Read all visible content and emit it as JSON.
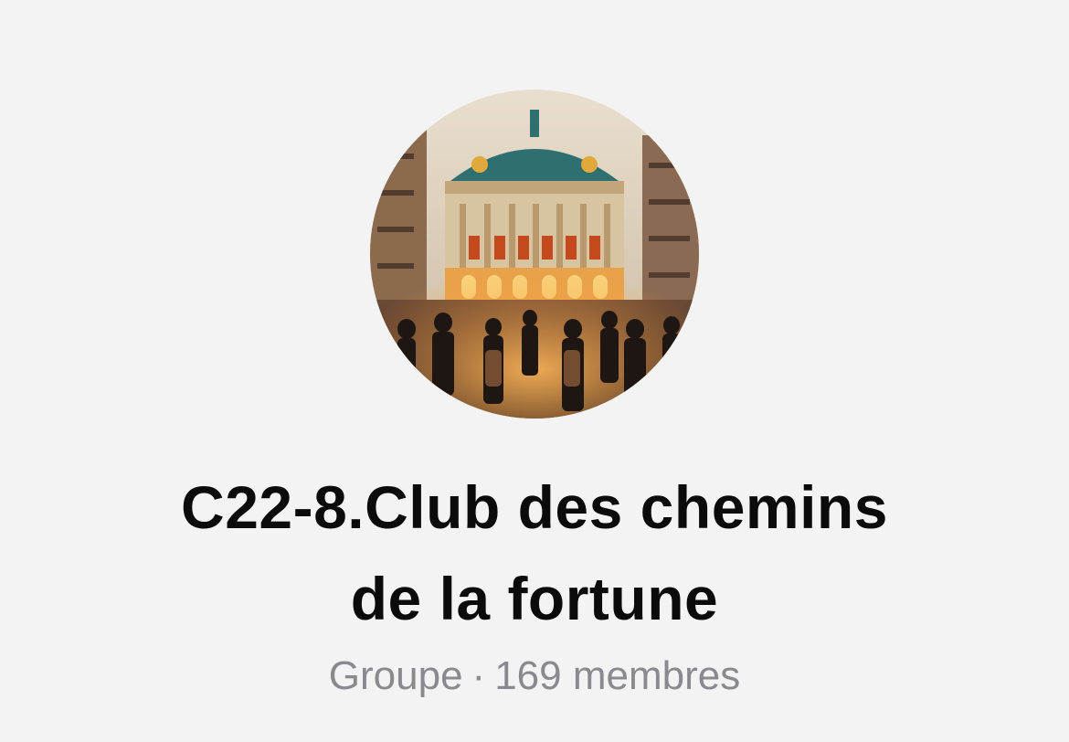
{
  "group": {
    "name_line1": "C22-8.Club des chemins",
    "name_line2": "de la fortune",
    "type": "Groupe",
    "separator": "·",
    "members": "169 membres"
  },
  "colors": {
    "background": "#f3f3f3",
    "title": "#0b0b0b",
    "subtitle": "#8a8a8e"
  },
  "icons": {
    "avatar": "opera-house-photo"
  }
}
